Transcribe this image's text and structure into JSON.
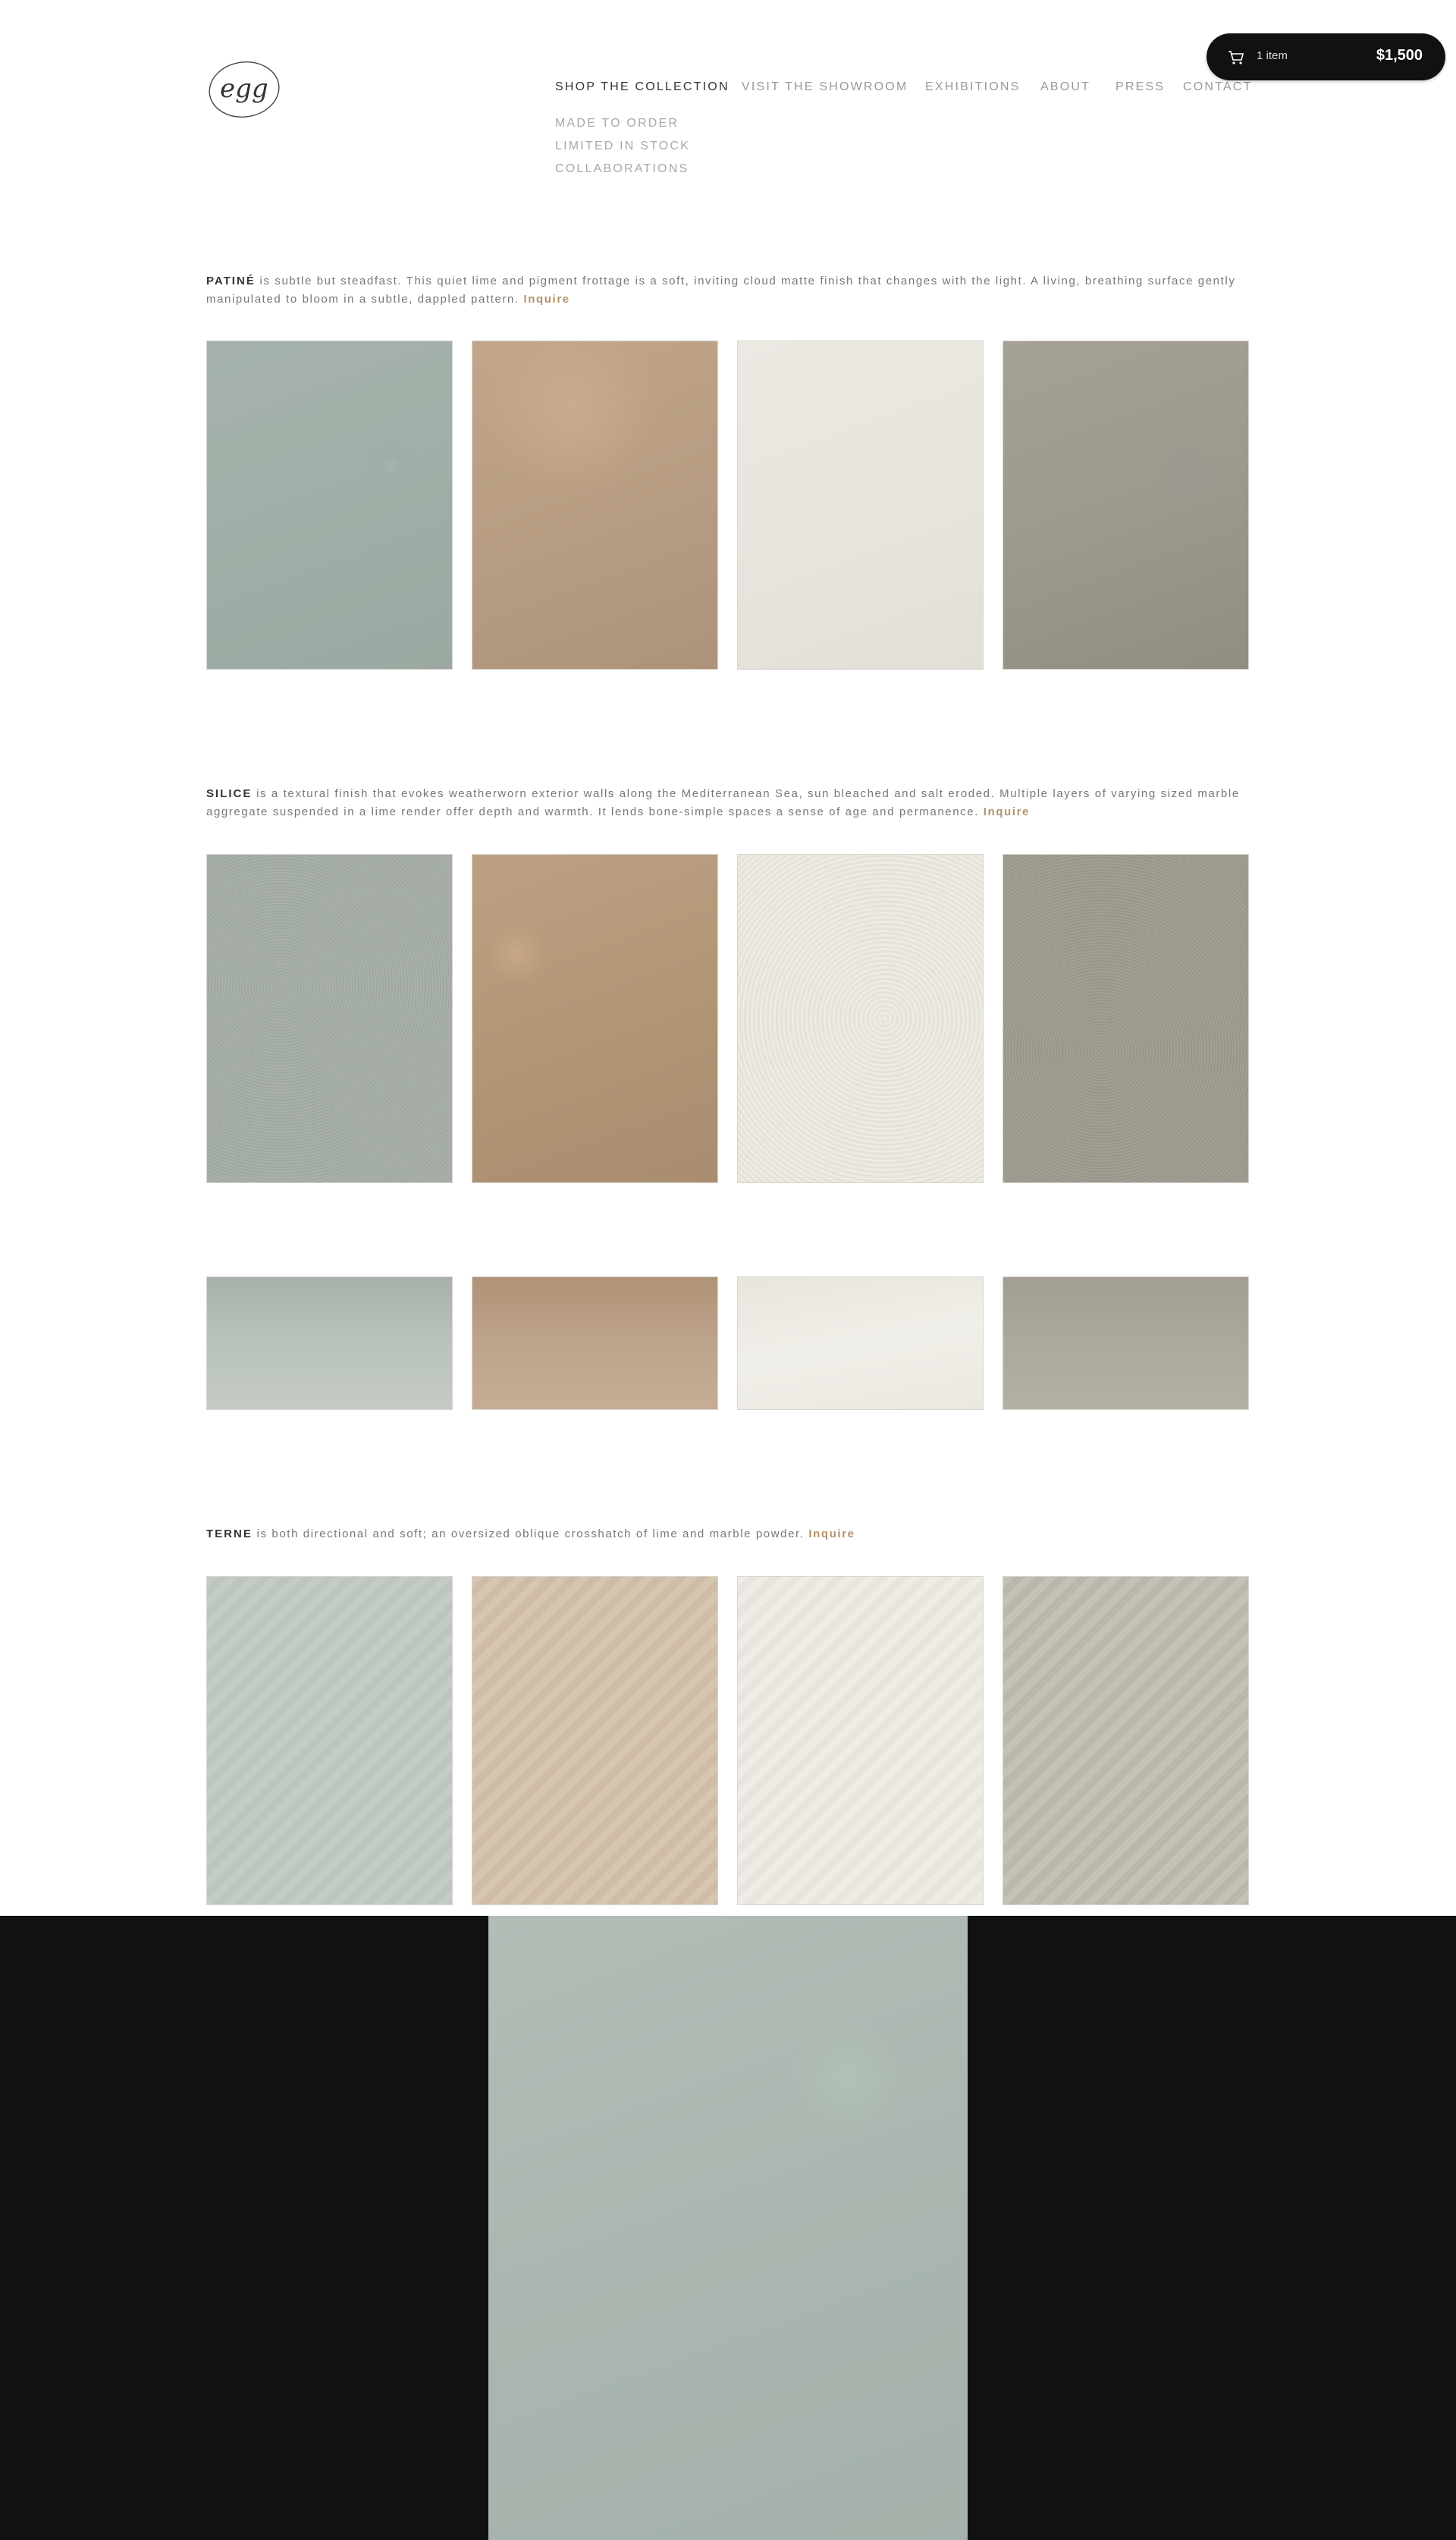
{
  "logo": {
    "text": "egg"
  },
  "nav": {
    "items": [
      {
        "label": "SHOP THE COLLECTION",
        "active": true
      },
      {
        "label": "VISIT THE SHOWROOM",
        "active": false
      },
      {
        "label": "EXHIBITIONS",
        "active": false
      },
      {
        "label": "ABOUT",
        "active": false
      },
      {
        "label": "PRESS",
        "active": false
      },
      {
        "label": "CONTACT",
        "active": false
      }
    ],
    "subitems": [
      "MADE TO ORDER",
      "LIMITED IN STOCK",
      "COLLABORATIONS"
    ]
  },
  "cart": {
    "icon": "cart-icon",
    "count": "1 item",
    "total": "$1,500"
  },
  "sections": [
    {
      "title": "PATINÉ",
      "text": " is subtle but steadfast. This quiet lime and pigment frottage is a soft, inviting cloud matte finish that changes with the light. A living, breathing surface gently manipulated to bloom in a subtle, dappled pattern. ",
      "inquire": "Inquire"
    },
    {
      "title": "SILICE",
      "text": " is a textural finish that evokes weatherworn exterior walls along the Mediterranean Sea, sun bleached and salt eroded. Multiple layers of varying sized marble aggregate suspended in a lime render offer depth and warmth. It lends bone-simple spaces a sense of age and permanence.  ",
      "inquire": "Inquire"
    },
    {
      "title": "TERNE",
      "text": " is both directional and soft; an oversized oblique crosshatch of lime and marble powder. ",
      "inquire": "Inquire"
    }
  ]
}
